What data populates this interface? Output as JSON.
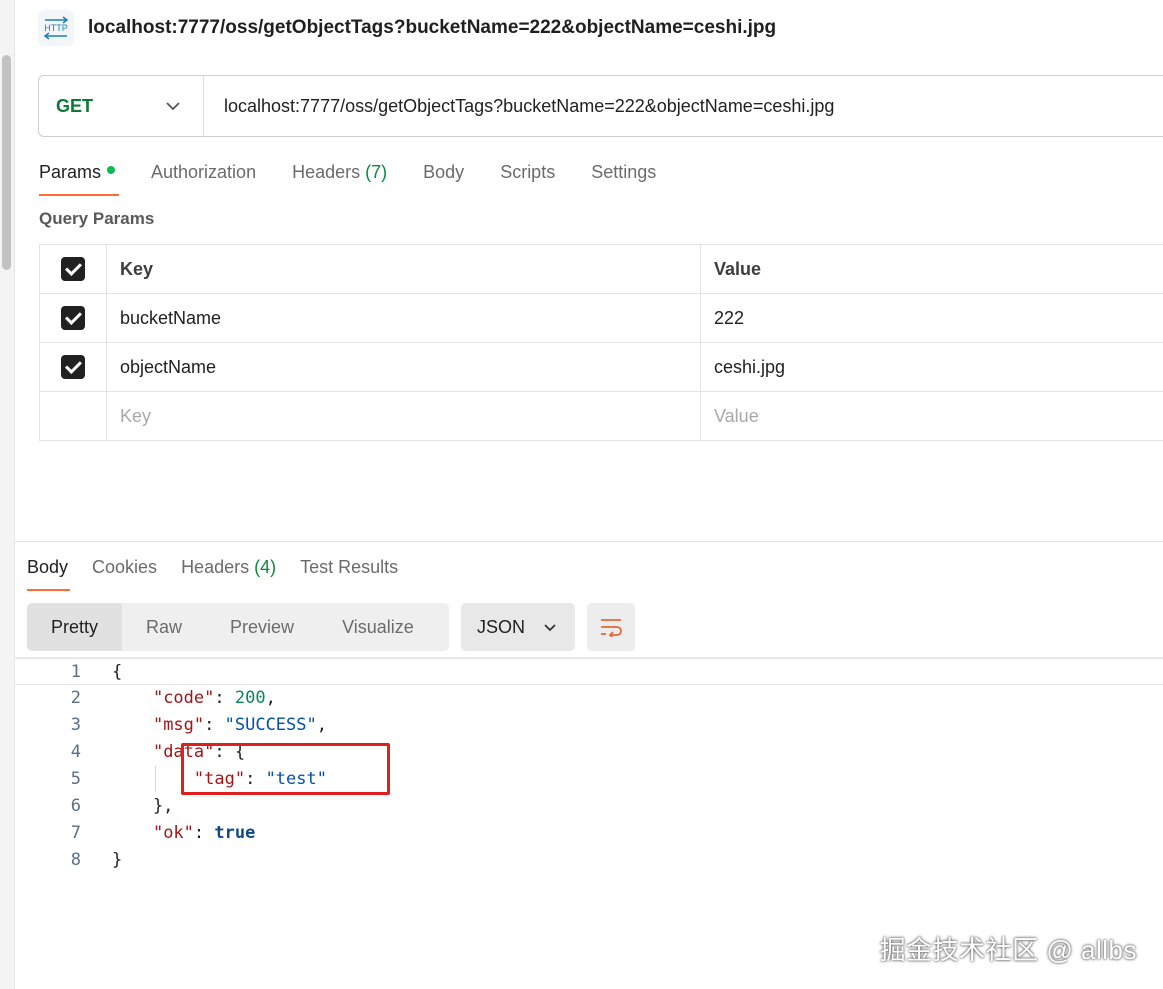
{
  "header": {
    "icon": "http-icon",
    "icon_label": "HTTP",
    "title": "localhost:7777/oss/getObjectTags?bucketName=222&objectName=ceshi.jpg"
  },
  "request": {
    "method": "GET",
    "url": "localhost:7777/oss/getObjectTags?bucketName=222&objectName=ceshi.jpg"
  },
  "request_tabs": [
    {
      "label": "Params",
      "active": true
    },
    {
      "label": "Authorization"
    },
    {
      "label": "Headers",
      "count": "(7)"
    },
    {
      "label": "Body"
    },
    {
      "label": "Scripts"
    },
    {
      "label": "Settings"
    }
  ],
  "query_params": {
    "title": "Query Params",
    "header": {
      "key": "Key",
      "value": "Value"
    },
    "rows": [
      {
        "key": "bucketName",
        "value": "222",
        "checked": true
      },
      {
        "key": "objectName",
        "value": "ceshi.jpg",
        "checked": true
      }
    ],
    "placeholder": {
      "key": "Key",
      "value": "Value"
    }
  },
  "response_tabs": [
    {
      "label": "Body",
      "active": true
    },
    {
      "label": "Cookies"
    },
    {
      "label": "Headers",
      "count": "(4)"
    },
    {
      "label": "Test Results"
    }
  ],
  "view_modes": [
    "Pretty",
    "Raw",
    "Preview",
    "Visualize"
  ],
  "active_view": "Pretty",
  "format": "JSON",
  "code_lines": {
    "l1": "1",
    "l2": "2",
    "l3": "3",
    "l4": "4",
    "l5": "5",
    "l6": "6",
    "l7": "7",
    "l8": "8",
    "code_key": "\"code\"",
    "code_val": "200",
    "msg_key": "\"msg\"",
    "msg_val": "\"SUCCESS\"",
    "data_key": "\"data\"",
    "tag_key": "\"tag\"",
    "tag_val": "\"test\"",
    "ok_key": "\"ok\"",
    "ok_val": "true"
  },
  "watermark": "掘金技术社区 @ allbs",
  "colors": {
    "accent": "#ff6c37",
    "method": "#0a7a36",
    "highlight": "#e0201f"
  }
}
